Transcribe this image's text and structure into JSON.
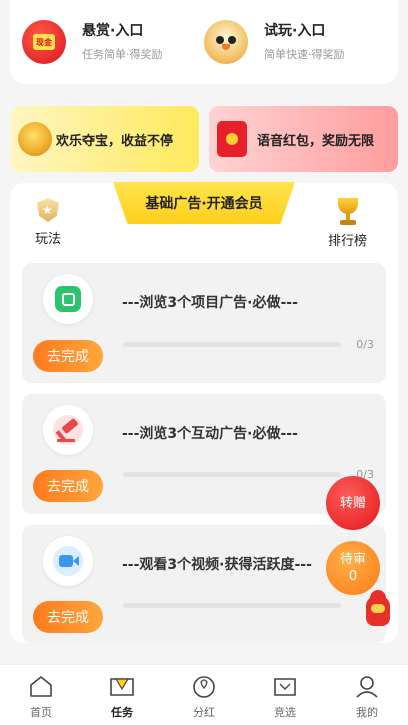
{
  "entries": [
    {
      "title": "悬赏·入口",
      "subtitle": "任务简单·得奖励",
      "badge": "现金",
      "icon": "red-envelope-icon"
    },
    {
      "title": "试玩·入口",
      "subtitle": "简单快速·得奖励",
      "icon": "bird-mascot-icon"
    }
  ],
  "banners": [
    {
      "label": "欢乐夺宝，收益不停",
      "icon": "treasure-icon"
    },
    {
      "label": "语音红包，奖励无限",
      "icon": "red-packet-icon"
    }
  ],
  "panel": {
    "tab_title": "基础广告·开通会员",
    "left_button": {
      "label": "玩法",
      "icon": "shield-star-icon"
    },
    "right_button": {
      "label": "排行榜",
      "icon": "trophy-icon"
    }
  },
  "tasks": [
    {
      "title": "---浏览3个项目广告·必做---",
      "button": "去完成",
      "progress": "0/3",
      "progress_value": 0,
      "icon": "camera-icon"
    },
    {
      "title": "---浏览3个互动广告·必做---",
      "button": "去完成",
      "progress": "0/3",
      "progress_value": 0,
      "icon": "gavel-icon"
    },
    {
      "title": "---观看3个视频·获得活跃度---",
      "button": "去完成",
      "progress": "",
      "progress_value": 0,
      "icon": "video-icon"
    }
  ],
  "floating": {
    "transfer_label": "转赠",
    "pending_label": "待审",
    "pending_count": "0"
  },
  "nav": [
    {
      "label": "首页",
      "icon": "home-icon",
      "active": false
    },
    {
      "label": "任务",
      "icon": "task-icon",
      "active": true
    },
    {
      "label": "分红",
      "icon": "dividend-icon",
      "active": false
    },
    {
      "label": "竞选",
      "icon": "election-icon",
      "active": false
    },
    {
      "label": "我的",
      "icon": "profile-icon",
      "active": false
    }
  ],
  "colors": {
    "accent_orange": "#ff8a2a",
    "accent_yellow": "#ffd21a",
    "accent_red": "#e01a1a"
  }
}
